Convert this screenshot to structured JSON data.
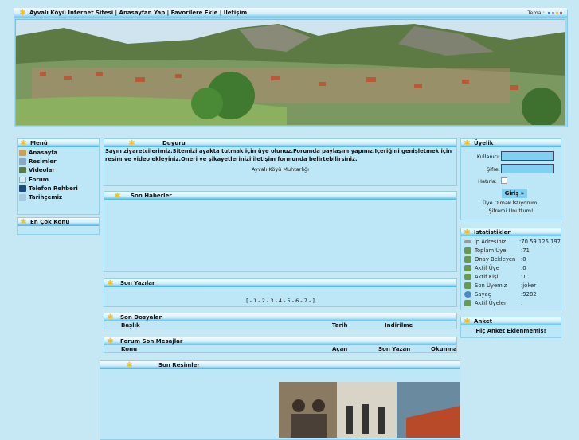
{
  "topbar": {
    "links": "Ayvalı Köyü Internet Sitesi | Anasayfan Yap | Favorilere Ekle | Iletişim",
    "tema": "Tema :",
    "theme_colors": [
      "#3a7de0",
      "#d080e0",
      "#f0c040",
      "#e05040"
    ]
  },
  "menu": {
    "title": "Menü",
    "items": [
      {
        "label": "Anasayfa",
        "icon": "home-icon"
      },
      {
        "label": "Resimler",
        "icon": "image-icon"
      },
      {
        "label": "Videolar",
        "icon": "film-icon"
      },
      {
        "label": "Forum",
        "icon": "chat-icon"
      },
      {
        "label": "Telefon Rehberi",
        "icon": "phone-book-icon"
      },
      {
        "label": "Tarihçemiz",
        "icon": "book-icon"
      }
    ]
  },
  "en_cok_konu": {
    "title": "En Çok Konu"
  },
  "duyuru": {
    "title": "Duyuru",
    "text": "Sayın ziyaretçilerimiz.Sitemizi ayakta tutmak için üye olunuz.Forumda paylaşım yapınız.Içeriğini genişletmek için resim ve video ekleyiniz.Oneri ve şikayetlerinizi iletişim formunda belirtebilirsiniz.",
    "signature": "Ayvalı Köyü Muhtarlığı"
  },
  "son_haberler": {
    "title": "Son Haberler"
  },
  "son_yazilar": {
    "title": "Son Yazılar",
    "pagination": "[ - 1 - 2 - 3 - 4 - 5 - 6 - 7 - ]"
  },
  "son_dosyalar": {
    "title": "Son Dosyalar",
    "columns": [
      "Başlık",
      "Tarih",
      "Indirilme"
    ]
  },
  "forum": {
    "title": "Forum Son Mesajlar",
    "columns": [
      "Konu",
      "Açan",
      "Son Yazan",
      "Okunma"
    ]
  },
  "son_resimler": {
    "title": "Son Resimler"
  },
  "uyelik": {
    "title": "Üyelik",
    "user_label": "Kullanıcı:",
    "pass_label": "Şifre:",
    "remember_label": "Hatırla:",
    "login": "Giriş »",
    "register": "Üye Olmak İstiyorum!",
    "forgot": "Şifremi Unuttum!"
  },
  "stats": {
    "title": "Istatistikler",
    "rows": [
      {
        "k": "İp Adresiniz",
        "v": ":70.59.126.197"
      },
      {
        "k": "Toplam Üye",
        "v": ":71"
      },
      {
        "k": "Onay Bekleyen",
        "v": ":0"
      },
      {
        "k": "Aktif Üye",
        "v": ":0"
      },
      {
        "k": "Aktif Kişi",
        "v": ":1"
      },
      {
        "k": "Son Üyemiz",
        "v": ":joker"
      },
      {
        "k": "Sayaç",
        "v": ":9282"
      },
      {
        "k": "Aktif Üyeler",
        "v": ":"
      }
    ]
  },
  "anket": {
    "title": "Anket",
    "text": "Hiç Anket Eklenmemiş!"
  }
}
